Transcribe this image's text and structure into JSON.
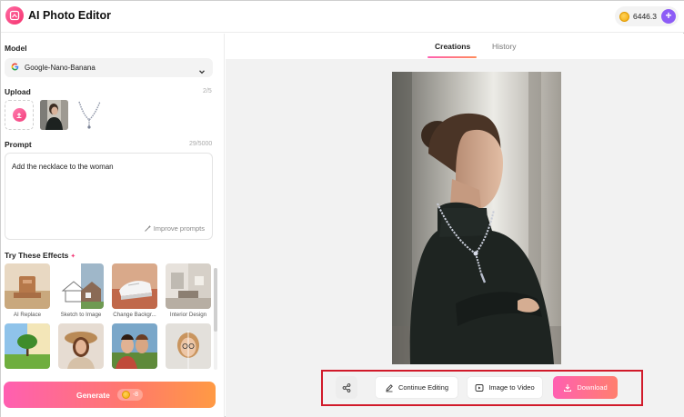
{
  "header": {
    "app_title": "AI Photo Editor",
    "credits": "6446.3",
    "plus_label": "+"
  },
  "left_panel": {
    "model": {
      "label": "Model",
      "selected": "Google-Nano-Banana",
      "provider_icon": "google-g-icon"
    },
    "upload": {
      "label": "Upload",
      "count": "2/5"
    },
    "prompt": {
      "label": "Prompt",
      "count": "29/5000",
      "value": "Add the necklace to the woman",
      "improve_label": "Improve prompts"
    },
    "effects": {
      "label": "Try These Effects",
      "items": [
        {
          "label": "AI Replace"
        },
        {
          "label": "Sketch to Image"
        },
        {
          "label": "Change Backgr..."
        },
        {
          "label": "Interior Design"
        },
        {
          "label": ""
        },
        {
          "label": ""
        },
        {
          "label": ""
        },
        {
          "label": ""
        }
      ]
    },
    "generate": {
      "label": "Generate",
      "cost": "-8"
    }
  },
  "right_panel": {
    "tabs": [
      {
        "label": "Creations",
        "active": true
      },
      {
        "label": "History",
        "active": false
      }
    ],
    "actions": {
      "continue_editing": "Continue Editing",
      "image_to_video": "Image to Video",
      "download": "Download"
    }
  },
  "colors": {
    "accent_pink": "#ff5fb1",
    "accent_purple": "#8d5cf6",
    "highlight_red": "#d11a2a"
  }
}
